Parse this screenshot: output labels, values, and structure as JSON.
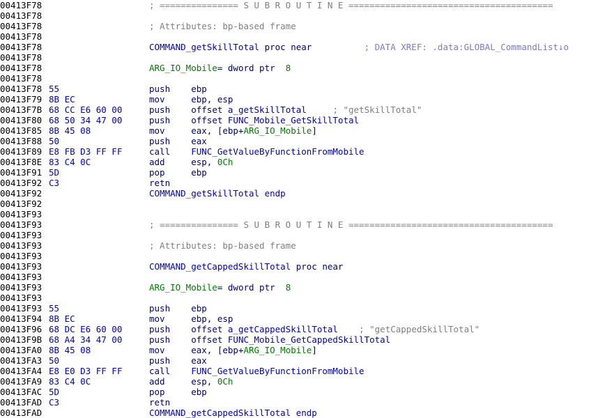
{
  "view": {
    "title": "IDA View-A",
    "background": "#ffffff",
    "colors": {
      "address": "#000000",
      "bytes": "#0000d0",
      "comment": "#808080",
      "xref": "#7b7bd9",
      "function_name": "#0000cc",
      "keyword": "#000080",
      "mnemonic": "#000080",
      "operand": "#000080",
      "variable": "#008000",
      "number": "#008000",
      "string_comment": "#808080"
    }
  },
  "lines": [
    {
      "addr": "00413F78",
      "bytes": "",
      "tokens": [
        {
          "t": "comment",
          "v": "; =============== S U B R O U T I N E ======================================="
        }
      ]
    },
    {
      "addr": "00413F78",
      "bytes": "",
      "tokens": []
    },
    {
      "addr": "00413F78",
      "bytes": "",
      "tokens": [
        {
          "t": "comment",
          "v": "; Attributes: bp-based frame"
        }
      ]
    },
    {
      "addr": "00413F78",
      "bytes": "",
      "tokens": []
    },
    {
      "addr": "00413F78",
      "bytes": "",
      "tokens": [
        {
          "t": "funcname",
          "v": "COMMAND_getSkillTotal"
        },
        {
          "t": "keyword",
          "v": " proc near"
        },
        {
          "t": "plain",
          "v": "          "
        },
        {
          "t": "xref",
          "v": "; DATA XREF: .data:GLOBAL_CommandList↓o"
        }
      ]
    },
    {
      "addr": "00413F78",
      "bytes": "",
      "tokens": []
    },
    {
      "addr": "00413F78",
      "bytes": "",
      "tokens": [
        {
          "t": "var",
          "v": "ARG_IO_Mobile"
        },
        {
          "t": "keyword",
          "v": "= dword ptr  "
        },
        {
          "t": "num",
          "v": "8"
        }
      ]
    },
    {
      "addr": "00413F78",
      "bytes": "",
      "tokens": []
    },
    {
      "addr": "00413F78",
      "bytes": "55",
      "tokens": [
        {
          "t": "mnem",
          "v": "push    "
        },
        {
          "t": "reg",
          "v": "ebp"
        }
      ]
    },
    {
      "addr": "00413F79",
      "bytes": "8B EC",
      "tokens": [
        {
          "t": "mnem",
          "v": "mov     "
        },
        {
          "t": "reg",
          "v": "ebp, esp"
        }
      ]
    },
    {
      "addr": "00413F7B",
      "bytes": "68 CC E6 60 00",
      "tokens": [
        {
          "t": "mnem",
          "v": "push    "
        },
        {
          "t": "keyword",
          "v": "offset "
        },
        {
          "t": "sym",
          "v": "a_getSkillTotal"
        },
        {
          "t": "plain",
          "v": "     "
        },
        {
          "t": "strlit",
          "v": "; \"getSkillTotal\""
        }
      ]
    },
    {
      "addr": "00413F80",
      "bytes": "68 50 34 47 00",
      "tokens": [
        {
          "t": "mnem",
          "v": "push    "
        },
        {
          "t": "keyword",
          "v": "offset "
        },
        {
          "t": "sym",
          "v": "FUNC_Mobile_GetSkillTotal"
        }
      ]
    },
    {
      "addr": "00413F85",
      "bytes": "8B 45 08",
      "tokens": [
        {
          "t": "mnem",
          "v": "mov     "
        },
        {
          "t": "reg",
          "v": "eax, [ebp+"
        },
        {
          "t": "var",
          "v": "ARG_IO_Mobile"
        },
        {
          "t": "reg",
          "v": "]"
        }
      ]
    },
    {
      "addr": "00413F88",
      "bytes": "50",
      "tokens": [
        {
          "t": "mnem",
          "v": "push    "
        },
        {
          "t": "reg",
          "v": "eax"
        }
      ]
    },
    {
      "addr": "00413F89",
      "bytes": "E8 FB D3 FF FF",
      "tokens": [
        {
          "t": "mnem",
          "v": "call    "
        },
        {
          "t": "sym",
          "v": "FUNC_GetValueByFunctionFromMobile"
        }
      ]
    },
    {
      "addr": "00413F8E",
      "bytes": "83 C4 0C",
      "tokens": [
        {
          "t": "mnem",
          "v": "add     "
        },
        {
          "t": "reg",
          "v": "esp, "
        },
        {
          "t": "num",
          "v": "0Ch"
        }
      ]
    },
    {
      "addr": "00413F91",
      "bytes": "5D",
      "tokens": [
        {
          "t": "mnem",
          "v": "pop     "
        },
        {
          "t": "reg",
          "v": "ebp"
        }
      ]
    },
    {
      "addr": "00413F92",
      "bytes": "C3",
      "tokens": [
        {
          "t": "mnem",
          "v": "retn"
        }
      ]
    },
    {
      "addr": "00413F92",
      "bytes": "",
      "tokens": [
        {
          "t": "funcname",
          "v": "COMMAND_getSkillTotal endp"
        }
      ]
    },
    {
      "addr": "00413F92",
      "bytes": "",
      "tokens": []
    },
    {
      "addr": "00413F93",
      "bytes": "",
      "tokens": []
    },
    {
      "addr": "00413F93",
      "bytes": "",
      "tokens": [
        {
          "t": "comment",
          "v": "; =============== S U B R O U T I N E ======================================="
        }
      ]
    },
    {
      "addr": "00413F93",
      "bytes": "",
      "tokens": []
    },
    {
      "addr": "00413F93",
      "bytes": "",
      "tokens": [
        {
          "t": "comment",
          "v": "; Attributes: bp-based frame"
        }
      ]
    },
    {
      "addr": "00413F93",
      "bytes": "",
      "tokens": []
    },
    {
      "addr": "00413F93",
      "bytes": "",
      "tokens": [
        {
          "t": "funcname",
          "v": "COMMAND_getCappedSkillTotal"
        },
        {
          "t": "keyword",
          "v": " proc near"
        }
      ]
    },
    {
      "addr": "00413F93",
      "bytes": "",
      "tokens": []
    },
    {
      "addr": "00413F93",
      "bytes": "",
      "tokens": [
        {
          "t": "var",
          "v": "ARG_IO_Mobile"
        },
        {
          "t": "keyword",
          "v": "= dword ptr  "
        },
        {
          "t": "num",
          "v": "8"
        }
      ]
    },
    {
      "addr": "00413F93",
      "bytes": "",
      "tokens": []
    },
    {
      "addr": "00413F93",
      "bytes": "55",
      "tokens": [
        {
          "t": "mnem",
          "v": "push    "
        },
        {
          "t": "reg",
          "v": "ebp"
        }
      ]
    },
    {
      "addr": "00413F94",
      "bytes": "8B EC",
      "tokens": [
        {
          "t": "mnem",
          "v": "mov     "
        },
        {
          "t": "reg",
          "v": "ebp, esp"
        }
      ]
    },
    {
      "addr": "00413F96",
      "bytes": "68 DC E6 60 00",
      "tokens": [
        {
          "t": "mnem",
          "v": "push    "
        },
        {
          "t": "keyword",
          "v": "offset "
        },
        {
          "t": "sym",
          "v": "a_getCappedSkillTotal"
        },
        {
          "t": "plain",
          "v": "    "
        },
        {
          "t": "strlit",
          "v": "; \"getCappedSkillTotal\""
        }
      ]
    },
    {
      "addr": "00413F9B",
      "bytes": "68 A4 34 47 00",
      "tokens": [
        {
          "t": "mnem",
          "v": "push    "
        },
        {
          "t": "keyword",
          "v": "offset "
        },
        {
          "t": "sym",
          "v": "FUNC_Mobile_GetCappedSkillTotal"
        }
      ]
    },
    {
      "addr": "00413FA0",
      "bytes": "8B 45 08",
      "tokens": [
        {
          "t": "mnem",
          "v": "mov     "
        },
        {
          "t": "reg",
          "v": "eax, [ebp+"
        },
        {
          "t": "var",
          "v": "ARG_IO_Mobile"
        },
        {
          "t": "reg",
          "v": "]"
        }
      ]
    },
    {
      "addr": "00413FA3",
      "bytes": "50",
      "tokens": [
        {
          "t": "mnem",
          "v": "push    "
        },
        {
          "t": "reg",
          "v": "eax"
        }
      ]
    },
    {
      "addr": "00413FA4",
      "bytes": "E8 E0 D3 FF FF",
      "tokens": [
        {
          "t": "mnem",
          "v": "call    "
        },
        {
          "t": "sym",
          "v": "FUNC_GetValueByFunctionFromMobile"
        }
      ]
    },
    {
      "addr": "00413FA9",
      "bytes": "83 C4 0C",
      "tokens": [
        {
          "t": "mnem",
          "v": "add     "
        },
        {
          "t": "reg",
          "v": "esp, "
        },
        {
          "t": "num",
          "v": "0Ch"
        }
      ]
    },
    {
      "addr": "00413FAC",
      "bytes": "5D",
      "tokens": [
        {
          "t": "mnem",
          "v": "pop     "
        },
        {
          "t": "reg",
          "v": "ebp"
        }
      ]
    },
    {
      "addr": "00413FAD",
      "bytes": "C3",
      "tokens": [
        {
          "t": "mnem",
          "v": "retn"
        }
      ]
    },
    {
      "addr": "00413FAD",
      "bytes": "",
      "tokens": [
        {
          "t": "funcname",
          "v": "COMMAND_getCappedSkillTotal endp"
        }
      ]
    }
  ]
}
